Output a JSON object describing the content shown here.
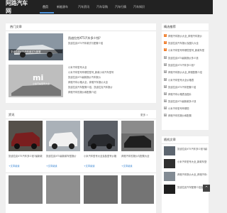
{
  "site": {
    "logo_text": "阿路汽车网"
  },
  "nav": {
    "items": [
      {
        "label": "首页"
      },
      {
        "label": "新能源车"
      },
      {
        "label": "汽车资讯"
      },
      {
        "label": "汽车导购"
      },
      {
        "label": "汽车行情"
      },
      {
        "label": "汽车知识"
      }
    ]
  },
  "hot_recommend": {
    "title": "热门文章",
    "featured": [
      {
        "title": "凯迪拉克XT5汽车款式与配置介绍",
        "caption": "凯迪拉克XT5汽车款式与配置"
      },
      {
        "title": "小米汽车型号大全",
        "logo": "mi"
      }
    ],
    "top_text_1": "凯迪拉克XT5汽车多少钱?",
    "top_text_2": "凯迪拉克XT5汽车款式与配置介绍",
    "list": [
      "小米汽车型号大全",
      "小米汽车型号有哪些型号_新款小米汽车型号",
      "凯迪拉克XT5最新报价汽车报价",
      "奔驰汽车价格大全，奔驰汽车报价大全",
      "凯迪拉克汽车配置介绍，凯迪拉克汽车报价",
      "奔驰汽车的报价和配置介绍"
    ]
  },
  "articles": {
    "title": "资讯",
    "more": "更多 »",
    "cards": [
      {
        "title": "凯迪拉克XT5汽车多少钱?最新款",
        "tag": "+文章阅读"
      },
      {
        "title": "凯迪拉克XT5最新款车型报价",
        "tag": "+文章阅读"
      },
      {
        "title": "小米汽车型号大全及各型号价格",
        "tag": "+文章阅读"
      },
      {
        "title": "奔驰汽车的报价与配置大全",
        "tag": "+文章阅读"
      }
    ]
  },
  "sidebar_latest": {
    "title": "精选推荐",
    "items": [
      "奔驰汽车报价大全_奔驰汽车报价",
      "凯迪拉克汽车报价及图片大全",
      "小米汽车型号有哪些型号_新款车型",
      "凯迪拉克XT5最新报价多少钱",
      "凯迪拉克XT5汽车多少钱?",
      "奔驰汽车报价大全_奔驰配置介绍",
      "小米汽车型号大全价格表",
      "凯迪拉克XT5汽车配置介绍",
      "奔驰汽车价格表及图片",
      "凯迪拉克XT5最新款多少钱",
      "小米汽车型号有哪些",
      "奔驰汽车的报价和配置"
    ]
  },
  "sidebar_tags": {
    "title": "随机文章",
    "items": [
      {
        "title": "凯迪拉克XT5汽车多少钱?最新款报价"
      },
      {
        "title": "小米汽车型号大全_新款车型介绍"
      },
      {
        "title": "奔驰汽车报价大全_奔驰汽车价格"
      },
      {
        "title": "凯迪拉克汽车配置介绍及报价大全"
      }
    ]
  },
  "colors": {
    "topbar": "#222222",
    "accent": "#4a90d9",
    "link": "#2f7fd0",
    "hot": "#f08030"
  }
}
